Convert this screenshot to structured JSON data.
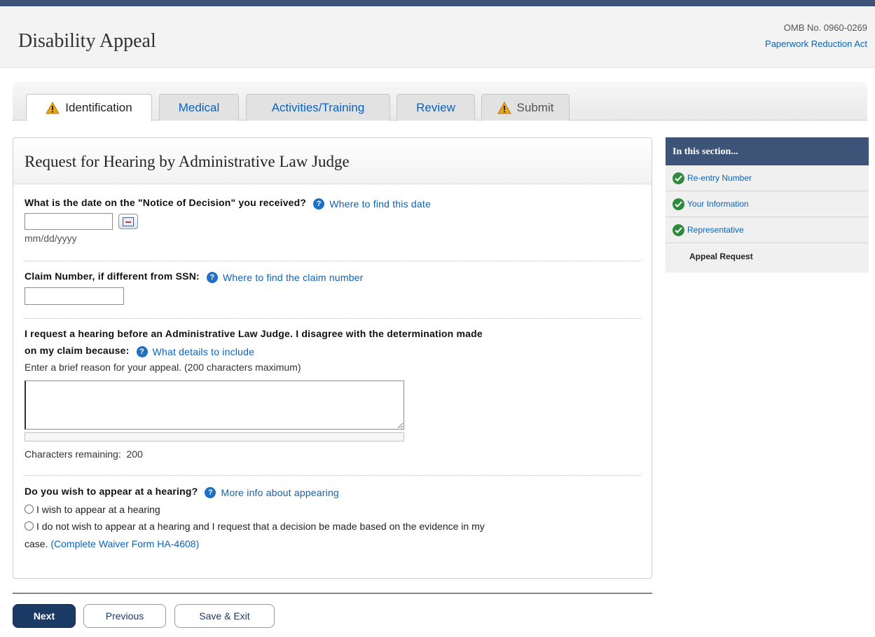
{
  "header": {
    "app_title": "Disability Appeal",
    "omb": "OMB No. 0960-0269",
    "paperwork_link": "Paperwork Reduction Act"
  },
  "tabs": [
    {
      "label": "Identification",
      "icon": "warning-icon",
      "state": "active"
    },
    {
      "label": "Medical",
      "state": "normal"
    },
    {
      "label": "Activities/Training",
      "state": "normal"
    },
    {
      "label": "Review",
      "state": "normal"
    },
    {
      "label": "Submit",
      "icon": "warning-icon",
      "state": "disabled"
    }
  ],
  "main": {
    "title": "Request for Hearing by Administrative Law Judge",
    "notice_date": {
      "label": "What is the date on the \"Notice of Decision\" you received?",
      "help": "Where to find this date",
      "value": "",
      "format_hint": "mm/dd/yyyy"
    },
    "claim_number": {
      "label": "Claim Number, if different from SSN:",
      "help": "Where to find the claim number",
      "value": ""
    },
    "reason": {
      "label_line1": "I request a hearing before an Administrative Law Judge. I disagree with the determination made",
      "label_line2": "on my claim because:",
      "help": "What details to include",
      "instruction": "Enter a brief reason for your appeal. (200 characters maximum)",
      "value": "",
      "chars_remaining_label": "Characters remaining:",
      "chars_remaining": "200"
    },
    "appear": {
      "label": "Do you wish to appear at a hearing?",
      "help": "More info about appearing",
      "option1": "I wish to appear at a hearing",
      "option2_line1": "I do not wish to appear at a hearing and I request that a decision be made based on the evidence in my",
      "option2_line2": "case.",
      "waiver_link": "(Complete Waiver Form HA-4608)"
    }
  },
  "sidebar": {
    "title": "In this section...",
    "items": [
      {
        "label": "Re-entry Number",
        "done": true
      },
      {
        "label": "Your Information",
        "done": true
      },
      {
        "label": "Representative",
        "done": true
      },
      {
        "label": "Appeal Request",
        "done": false
      }
    ]
  },
  "buttons": {
    "next": "Next",
    "previous": "Previous",
    "save_exit": "Save & Exit"
  },
  "colors": {
    "brand_navy": "#3d5478",
    "link_blue": "#0b62b8",
    "check_green": "#2e8b3d"
  }
}
